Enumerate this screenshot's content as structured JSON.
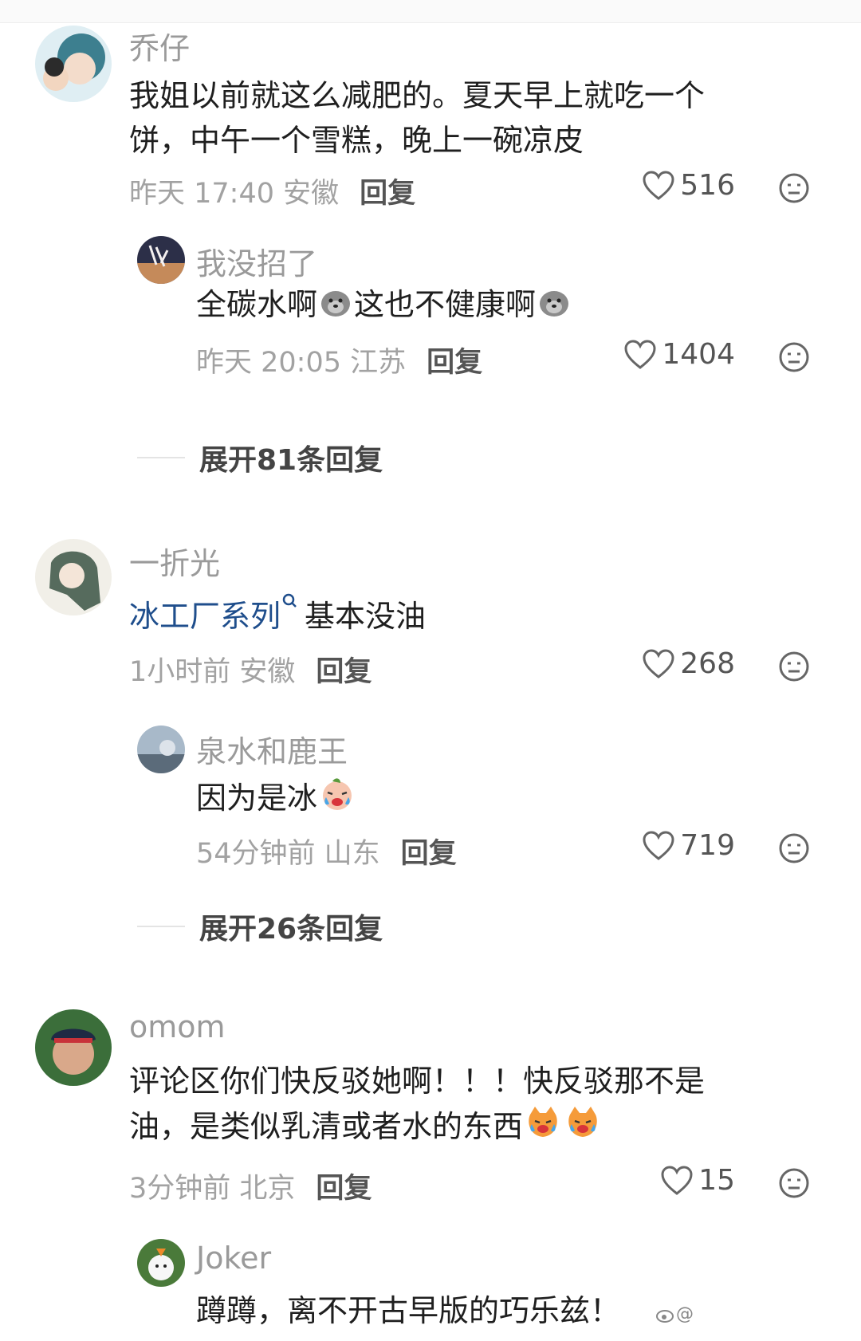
{
  "comments": [
    {
      "username": "乔仔",
      "text": "我姐以前就这么减肥的。夏天早上就吃一个饼，中午一个雪糕，晚上一碗凉皮",
      "time_location": "昨天 17:40 安徽",
      "reply_label": "回复",
      "likes": "516",
      "replies": [
        {
          "username": "我没招了",
          "text": "全碳水啊",
          "text2": "这也不健康啊",
          "time_location": "昨天 20:05 江苏",
          "reply_label": "回复",
          "likes": "1404"
        }
      ],
      "expand_label": "展开81条回复"
    },
    {
      "username": "一折光",
      "link_text": "冰工厂系列",
      "text": "基本没油",
      "time_location": "1小时前 安徽",
      "reply_label": "回复",
      "likes": "268",
      "replies": [
        {
          "username": "泉水和鹿王",
          "text": "因为是冰",
          "time_location": "54分钟前 山东",
          "reply_label": "回复",
          "likes": "719"
        }
      ],
      "expand_label": "展开26条回复"
    },
    {
      "username": "omom",
      "text": "评论区你们快反驳她啊！！！快反驳那不是油，是类似乳清或者水的东西",
      "time_location": "3分钟前 北京",
      "reply_label": "回复",
      "likes": "15",
      "replies": [
        {
          "username": "Joker",
          "text": "蹲蹲，离不开古早版的巧乐兹！"
        }
      ]
    }
  ],
  "watermark": "@",
  "icons": {
    "like": "heart-outline-icon",
    "dislike": "meh-face-icon",
    "search_link": "search-icon"
  },
  "colors": {
    "username": "#9a9a9a",
    "link": "#1f4e8c",
    "meta": "#a2a2a2"
  }
}
